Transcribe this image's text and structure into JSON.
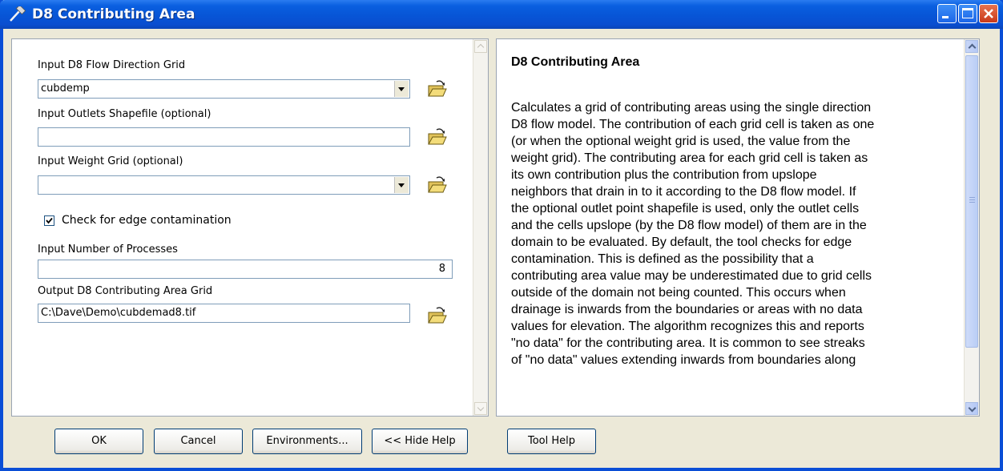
{
  "window": {
    "title": "D8 Contributing Area",
    "title_icon": "hammer-icon"
  },
  "form": {
    "flow_dir_label": "Input D8 Flow Direction Grid",
    "flow_dir_value": "cubdemp",
    "outlets_label": "Input Outlets Shapefile (optional)",
    "outlets_value": "",
    "weight_label": "Input Weight Grid (optional)",
    "weight_value": "",
    "edge_check_label": "Check for edge contamination",
    "edge_checked": true,
    "processes_label": "Input Number of Processes",
    "processes_value": "8",
    "output_label": "Output D8 Contributing Area Grid",
    "output_value": "C:\\Dave\\Demo\\cubdemad8.tif"
  },
  "help": {
    "title": "D8 Contributing Area",
    "lines": [
      "Calculates a grid of contributing areas using the single direction",
      "D8 flow model. The contribution of each grid cell is taken as one",
      "(or when the optional weight grid is used, the value from the",
      "weight grid). The contributing area for each grid cell is taken as",
      "its own contribution plus the contribution from upslope",
      "neighbors that drain in to it according to the D8 flow model. If",
      "the optional outlet point shapefile is used, only the outlet cells",
      "and the cells upslope (by the D8 flow model) of them are in the",
      "domain to be evaluated. By default, the tool checks for edge",
      "contamination. This is defined as the possibility that a",
      "contributing area value may be underestimated due to grid cells",
      "outside of the domain not being counted. This occurs when",
      "drainage is inwards from the boundaries or areas with no data",
      "values for elevation. The algorithm recognizes this and reports",
      "\"no data\" for the contributing area. It is common to see streaks",
      "of \"no data\" values extending inwards from boundaries along"
    ]
  },
  "buttons": {
    "ok": "OK",
    "cancel": "Cancel",
    "environments": "Environments...",
    "hide_help": "<< Hide Help",
    "tool_help": "Tool Help"
  }
}
